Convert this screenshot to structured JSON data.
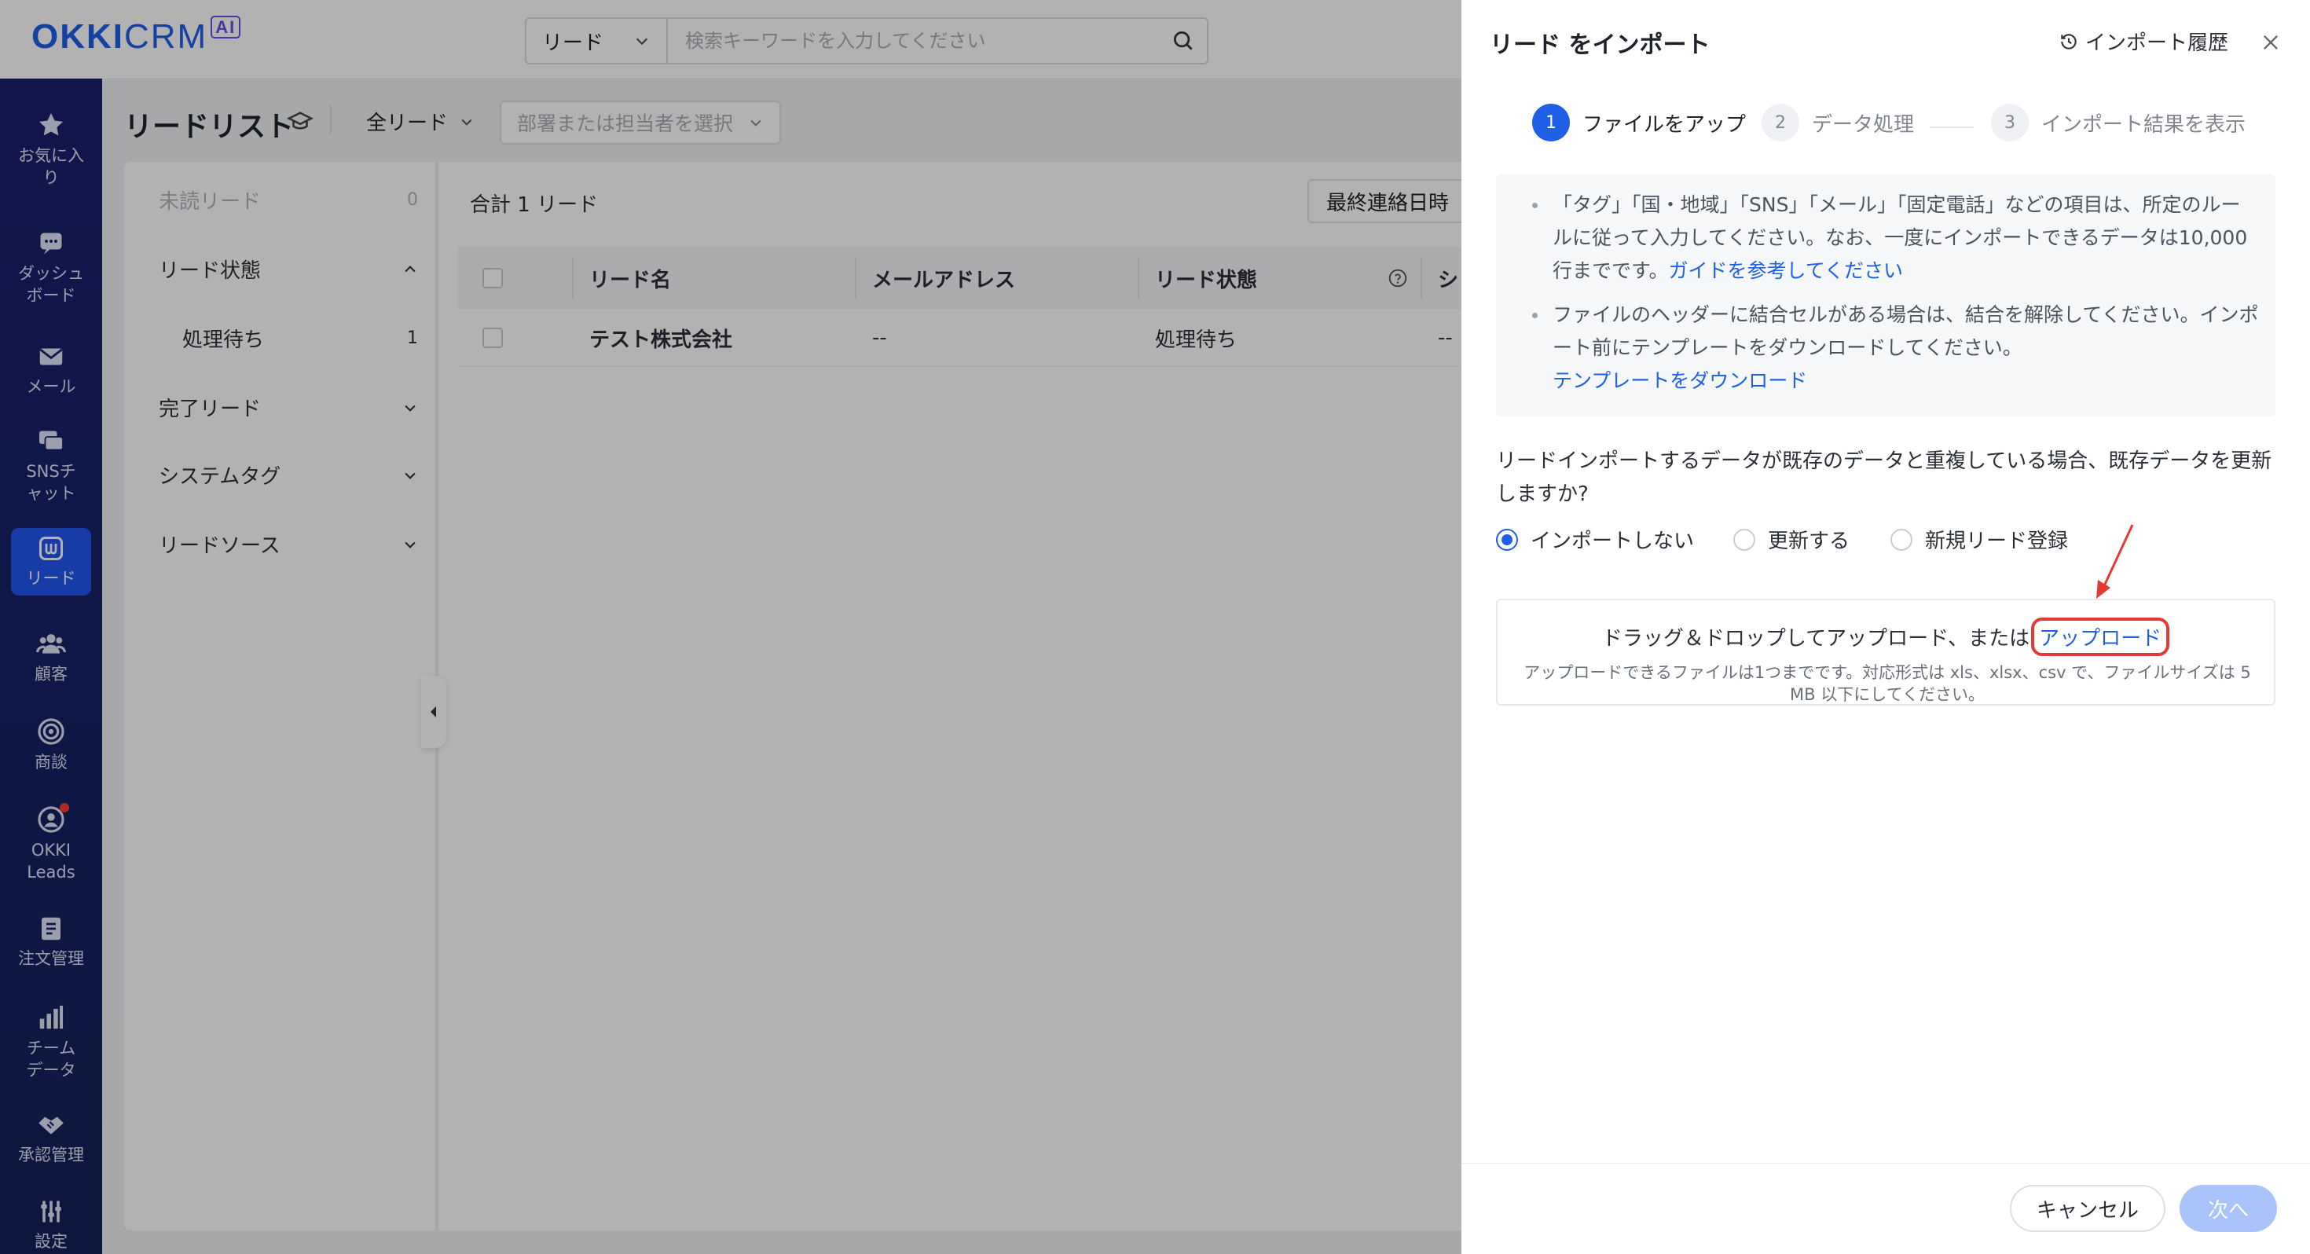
{
  "header": {
    "logo_okki": "OKKI",
    "logo_crm": "CRM",
    "logo_ai": "AI",
    "search_type": "リード",
    "search_placeholder": "検索キーワードを入力してください"
  },
  "nav": [
    {
      "label": "お気に入り",
      "icon": "star-icon"
    },
    {
      "label": "ダッシュボード",
      "icon": "dashboard-icon"
    },
    {
      "label": "メール",
      "icon": "mail-icon"
    },
    {
      "label": "SNSチャット",
      "icon": "chat-icon"
    },
    {
      "label": "リード",
      "icon": "lead-icon",
      "active": true
    },
    {
      "label": "顧客",
      "icon": "customers-icon"
    },
    {
      "label": "商談",
      "icon": "target-icon"
    },
    {
      "label": "OKKI Leads",
      "icon": "okki-leads-icon",
      "badge": true
    },
    {
      "label": "注文管理",
      "icon": "order-icon"
    },
    {
      "label": "チームデータ",
      "icon": "chart-icon"
    },
    {
      "label": "承認管理",
      "icon": "handshake-icon"
    },
    {
      "label": "設定",
      "icon": "settings-icon"
    }
  ],
  "list": {
    "title": "リードリスト",
    "all_leads": "全リード",
    "dept_placeholder": "部署または担当者を選択",
    "total": "合計 1 リード",
    "sort_label": "最終連絡日時",
    "side": {
      "unread_label": "未読リード",
      "unread_count": "0",
      "status_label": "リード状態",
      "pending_label": "処理待ち",
      "pending_count": "1",
      "done_label": "完了リード",
      "system_tags_label": "システムタグ",
      "source_label": "リードソース"
    },
    "columns": [
      "リード名",
      "メールアドレス",
      "リード状態",
      "シ"
    ],
    "rows": [
      {
        "name": "テスト株式会社",
        "email": "--",
        "status": "処理待ち",
        "extra": "--"
      }
    ]
  },
  "drawer": {
    "title": "リード をインポート",
    "history_label": "インポート履歴",
    "steps": [
      {
        "num": "1",
        "label": "ファイルをアップ"
      },
      {
        "num": "2",
        "label": "データ処理"
      },
      {
        "num": "3",
        "label": "インポート結果を表示"
      }
    ],
    "notice": {
      "p1_text": "「タグ」「国・地域」「SNS」「メール」「固定電話」などの項目は、所定のルールに従って入力してください。なお、一度にインポートできるデータは10,000行までです。",
      "p1_link": "ガイドを参考してください",
      "p2_text": "ファイルのヘッダーに結合セルがある場合は、結合を解除してください。インポート前にテンプレートをダウンロードしてください。",
      "p2_link": "テンプレートをダウンロード"
    },
    "dup_question": "リードインポートするデータが既存のデータと重複している場合、既存データを更新しますか?",
    "radio_options": [
      {
        "label": "インポートしない",
        "checked": true
      },
      {
        "label": "更新する",
        "checked": false
      },
      {
        "label": "新規リード登録",
        "checked": false
      }
    ],
    "upload_text": "ドラッグ＆ドロップしてアップロード、または",
    "upload_link": "アップロード",
    "upload_hint": "アップロードできるファイルは1つまでです。対応形式は xls、xlsx、csv で、ファイルサイズは 5 MB 以下にしてください。",
    "cancel_label": "キャンセル",
    "next_label": "次へ"
  },
  "colors": {
    "accent": "#1f5fe6",
    "nav_bg": "#152166",
    "highlight_red": "#e53935"
  }
}
